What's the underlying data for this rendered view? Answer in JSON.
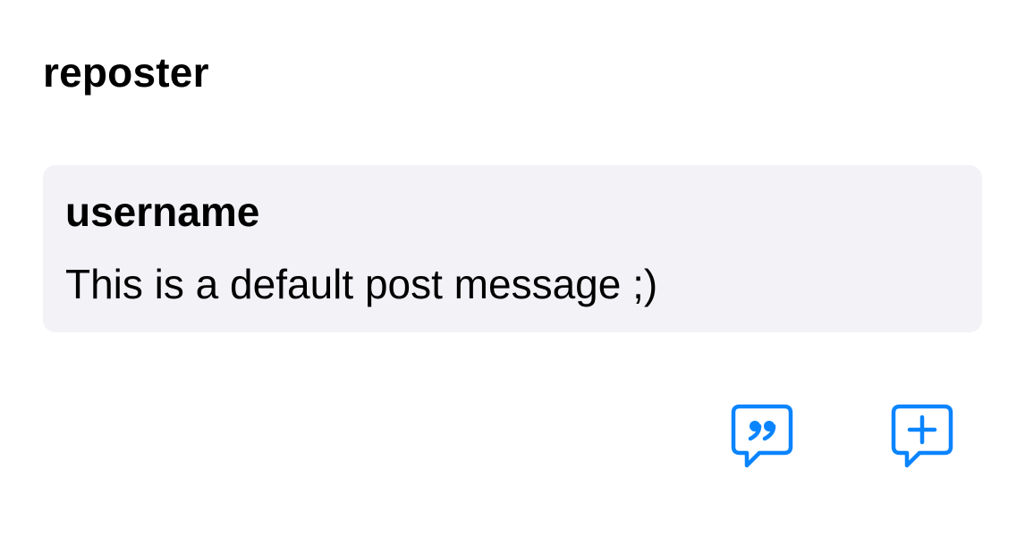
{
  "repost": {
    "reposter_name": "reposter"
  },
  "post": {
    "username": "username",
    "message": "This is a default post message ;)"
  },
  "actions": [
    {
      "icon": "quote-bubble-icon"
    },
    {
      "icon": "add-bubble-icon"
    }
  ],
  "colors": {
    "accent": "#0A84FF",
    "card_background": "#F2F2F7",
    "text": "#000000"
  }
}
